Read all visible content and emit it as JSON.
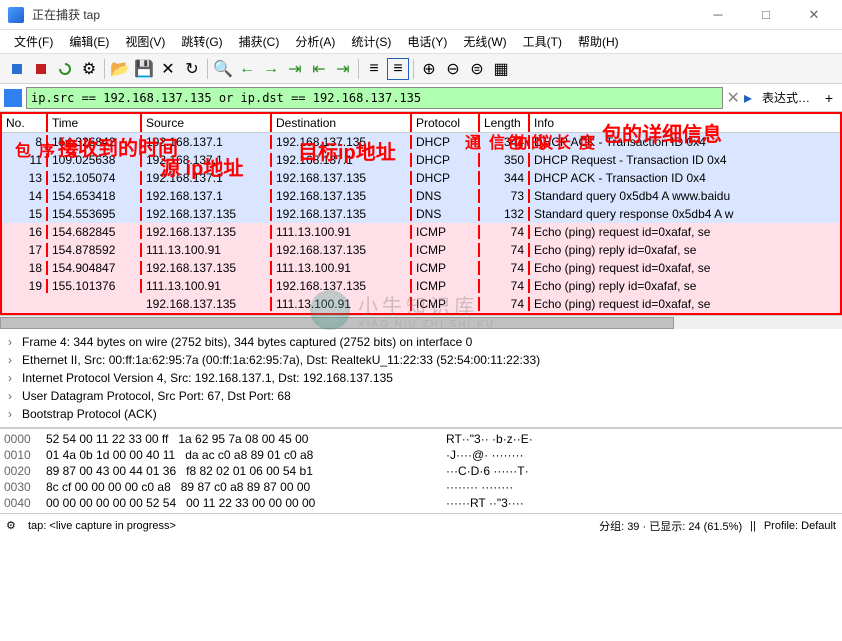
{
  "window": {
    "title": "正在捕获 tap"
  },
  "menus": [
    "文件(F)",
    "编辑(E)",
    "视图(V)",
    "跳转(G)",
    "捕获(C)",
    "分析(A)",
    "统计(S)",
    "电话(Y)",
    "无线(W)",
    "工具(T)",
    "帮助(H)"
  ],
  "filter": {
    "value": "ip.src == 192.168.137.135 or ip.dst == 192.168.137.135",
    "expression": "表达式…"
  },
  "columns": {
    "no": "No.",
    "time": "Time",
    "source": "Source",
    "destination": "Destination",
    "protocol": "Protocol",
    "length": "Length",
    "info": "Info"
  },
  "annotations": {
    "no": "包序号",
    "time": "接收到的时间",
    "source": "源 ip地址",
    "destination": "目标ip地址",
    "protocol": "通信协议",
    "length": "包的长度",
    "info": "包的详细信息"
  },
  "packets": [
    {
      "no": "8",
      "time": "154.326842",
      "src": "192.168.137.1",
      "dst": "192.168.137.135",
      "proto": "DHCP",
      "len": "344",
      "info": "DHCP ACK      - Transaction ID 0x4",
      "cls": "blue"
    },
    {
      "no": "11",
      "time": "109.025638",
      "src": "192.168.137.1",
      "dst": "192.168.137.1",
      "proto": "DHCP",
      "len": "350",
      "info": "DHCP Request  - Transaction ID 0x4",
      "cls": "blue"
    },
    {
      "no": "13",
      "time": "152.105074",
      "src": "192.168.137.1",
      "dst": "192.168.137.135",
      "proto": "DHCP",
      "len": "344",
      "info": "DHCP ACK      - Transaction ID 0x4",
      "cls": "blue"
    },
    {
      "no": "14",
      "time": "154.653418",
      "src": "192.168.137.1",
      "dst": "192.168.137.135",
      "proto": "DNS",
      "len": "73",
      "info": "Standard query 0x5db4 A www.baidu",
      "cls": "blue"
    },
    {
      "no": "15",
      "time": "154.553695",
      "src": "192.168.137.135",
      "dst": "192.168.137.135",
      "proto": "DNS",
      "len": "132",
      "info": "Standard query response 0x5db4 A w",
      "cls": "blue"
    },
    {
      "no": "16",
      "time": "154.682845",
      "src": "192.168.137.135",
      "dst": "111.13.100.91",
      "proto": "ICMP",
      "len": "74",
      "info": "Echo (ping) request  id=0xafaf, se",
      "cls": "pink"
    },
    {
      "no": "17",
      "time": "154.878592",
      "src": "111.13.100.91",
      "dst": "192.168.137.135",
      "proto": "ICMP",
      "len": "74",
      "info": "Echo (ping) reply    id=0xafaf, se",
      "cls": "pink"
    },
    {
      "no": "18",
      "time": "154.904847",
      "src": "192.168.137.135",
      "dst": "111.13.100.91",
      "proto": "ICMP",
      "len": "74",
      "info": "Echo (ping) request  id=0xafaf, se",
      "cls": "pink"
    },
    {
      "no": "19",
      "time": "155.101376",
      "src": "111.13.100.91",
      "dst": "192.168.137.135",
      "proto": "ICMP",
      "len": "74",
      "info": "Echo (ping) reply    id=0xafaf, se",
      "cls": "pink"
    },
    {
      "no": "",
      "time": "",
      "src": "192.168.137.135",
      "dst": "111.13.100.91",
      "proto": "ICMP",
      "len": "74",
      "info": "Echo (ping) request  id=0xafaf, se",
      "cls": "pink"
    }
  ],
  "details": [
    "Frame 4: 344 bytes on wire (2752 bits), 344 bytes captured (2752 bits) on interface 0",
    "Ethernet II, Src: 00:ff:1a:62:95:7a (00:ff:1a:62:95:7a), Dst: RealtekU_11:22:33 (52:54:00:11:22:33)",
    "Internet Protocol Version 4, Src: 192.168.137.1, Dst: 192.168.137.135",
    "User Datagram Protocol, Src Port: 67, Dst Port: 68",
    "Bootstrap Protocol (ACK)"
  ],
  "hex": [
    {
      "off": "0000",
      "b": "52 54 00 11 22 33 00 ff   1a 62 95 7a 08 00 45 00",
      "a": "RT··\"3·· ·b·z··E·"
    },
    {
      "off": "0010",
      "b": "01 4a 0b 1d 00 00 40 11   da ac c0 a8 89 01 c0 a8",
      "a": "·J····@· ········"
    },
    {
      "off": "0020",
      "b": "89 87 00 43 00 44 01 36   f8 82 02 01 06 00 54 b1",
      "a": "···C·D·6 ······T·"
    },
    {
      "off": "0030",
      "b": "8c cf 00 00 00 00 c0 a8   89 87 c0 a8 89 87 00 00",
      "a": "········ ········"
    },
    {
      "off": "0040",
      "b": "00 00 00 00 00 00 52 54   00 11 22 33 00 00 00 00",
      "a": "······RT ··\"3····"
    }
  ],
  "status": {
    "capture": "tap: <live capture in progress>",
    "packets": "分组: 39 · 已显示: 24 (61.5%)",
    "profile": "Profile: Default"
  },
  "watermark": {
    "cn": "小牛知识库",
    "en": "XIAO NIU ZHI SHI KU"
  }
}
